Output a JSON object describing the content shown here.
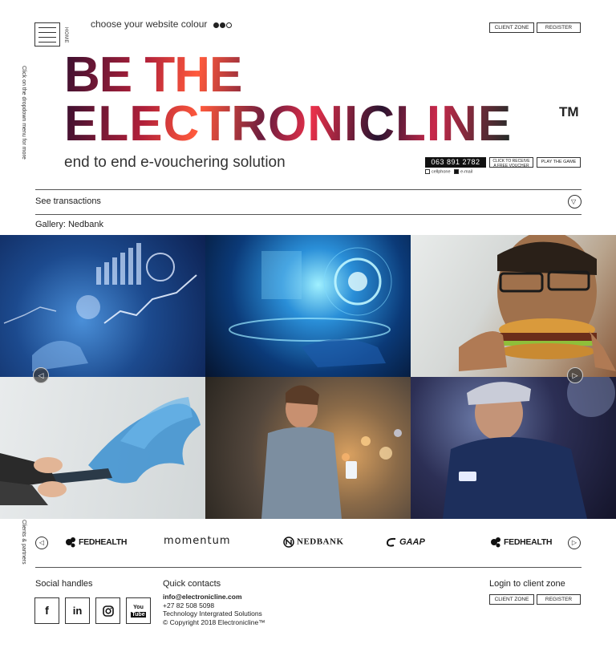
{
  "header": {
    "home_label": "HOME",
    "colour_prompt": "choose your website colour",
    "client_zone": "CLIENT ZONE",
    "register": "REGISTER",
    "side_hint": "Click on the dropdown menu for more"
  },
  "hero": {
    "line1": "BE THE",
    "line2": "ELECTRONICLINE",
    "trademark": "TM",
    "tagline": "end to end e-vouchering solution",
    "phone": "063 891 2782",
    "voucher_line1": "CLICK TO RECEIVE",
    "voucher_line2": "A FREE VOUCHER",
    "game": "PLAY THE GAME",
    "option_cell": "cellphone",
    "option_email": "e-mail"
  },
  "transactions": {
    "label": "See transactions"
  },
  "gallery": {
    "label": "Gallery: Nedbank"
  },
  "clients": {
    "side_label": "Clients & partners",
    "logos": [
      "FEDHEALTH",
      "momentum",
      "NEDBANK",
      "GAAP",
      "FEDHEALTH"
    ]
  },
  "footer": {
    "social_title": "Social handles",
    "social_fb": "f",
    "social_in": "in",
    "social_yt_1": "You",
    "social_yt_2": "Tube",
    "quick_title": "Quick contacts",
    "email": "info@electronicline.com",
    "phone": "+27 82 508 5098",
    "company": "Technology Intergrated Solutions",
    "copyright": "© Copyright 2018 Electronicline™",
    "login_title": "Login to client zone",
    "client_zone": "CLIENT ZONE",
    "register": "REGISTER"
  },
  "colors": {
    "accent_red": "#e8304a",
    "dark": "#111111"
  },
  "icons": {
    "menu": "hamburger-icon",
    "toggle": "chevron-down-circle-icon",
    "prev": "chevron-left-circle-icon",
    "next": "chevron-right-circle-icon",
    "instagram": "instagram-icon"
  }
}
